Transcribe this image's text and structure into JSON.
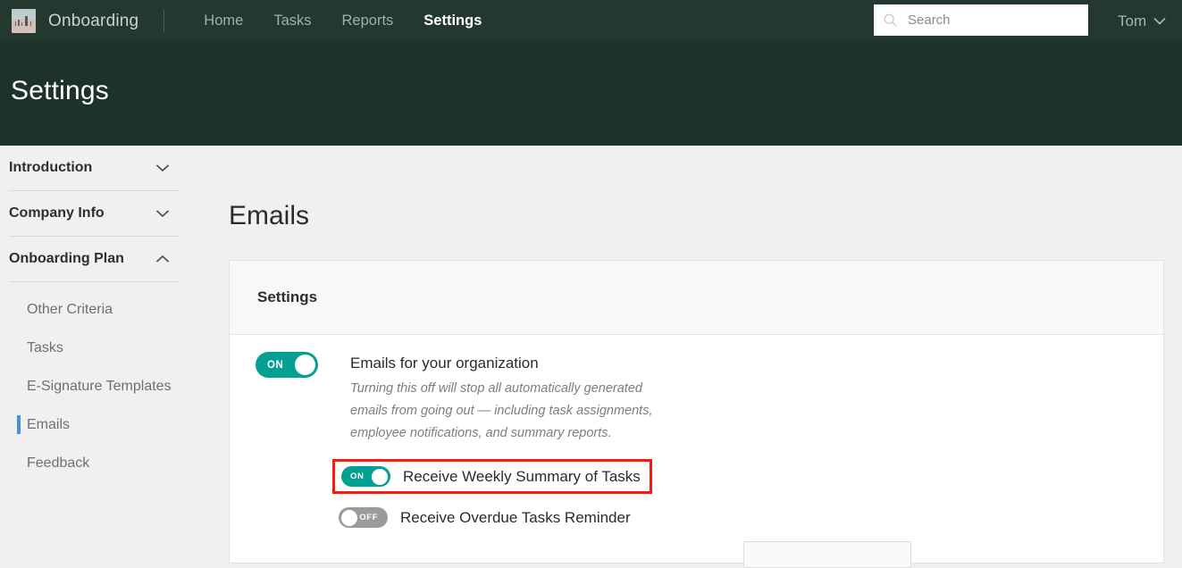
{
  "topbar": {
    "brand_name": "Onboarding",
    "logo_icon": "photo-logo-icon",
    "nav": [
      {
        "label": "Home",
        "active": false
      },
      {
        "label": "Tasks",
        "active": false
      },
      {
        "label": "Reports",
        "active": false
      },
      {
        "label": "Settings",
        "active": true
      }
    ],
    "search": {
      "placeholder": "Search",
      "value": "",
      "icon": "search-icon"
    },
    "user": {
      "name": "Tom",
      "chevron_icon": "chevron-down-icon"
    }
  },
  "hero": {
    "title": "Settings"
  },
  "sidebar": {
    "groups": [
      {
        "label": "Introduction",
        "expanded": false,
        "chevron": "chevron-down-icon"
      },
      {
        "label": "Company Info",
        "expanded": false,
        "chevron": "chevron-down-icon"
      },
      {
        "label": "Onboarding Plan",
        "expanded": true,
        "chevron": "chevron-up-icon"
      }
    ],
    "items": [
      {
        "label": "Other Criteria",
        "active": false
      },
      {
        "label": "Tasks",
        "active": false
      },
      {
        "label": "E-Signature Templates",
        "active": false
      },
      {
        "label": "Emails",
        "active": true
      },
      {
        "label": "Feedback",
        "active": false
      }
    ]
  },
  "main": {
    "title": "Emails",
    "card": {
      "header_title": "Settings",
      "primary_toggle": {
        "state": "ON",
        "label": "Emails for your organization",
        "description": "Turning this off will stop all automatically generated emails from going out — including task assignments, employee notifications, and summary reports."
      },
      "sub_toggles": [
        {
          "state": "ON",
          "label": "Receive Weekly Summary of Tasks",
          "highlighted": true
        },
        {
          "state": "OFF",
          "label": "Receive Overdue Tasks Reminder",
          "highlighted": false
        }
      ]
    }
  },
  "colors": {
    "topbar_green": "#23382f",
    "hero_green": "#1d322a",
    "toggle_on_teal": "#04a091",
    "toggle_off_gray": "#9b9b9b",
    "highlight_red": "#f51b0d",
    "active_item_blue": "#4a90d9",
    "page_background": "#f0f0f0"
  }
}
